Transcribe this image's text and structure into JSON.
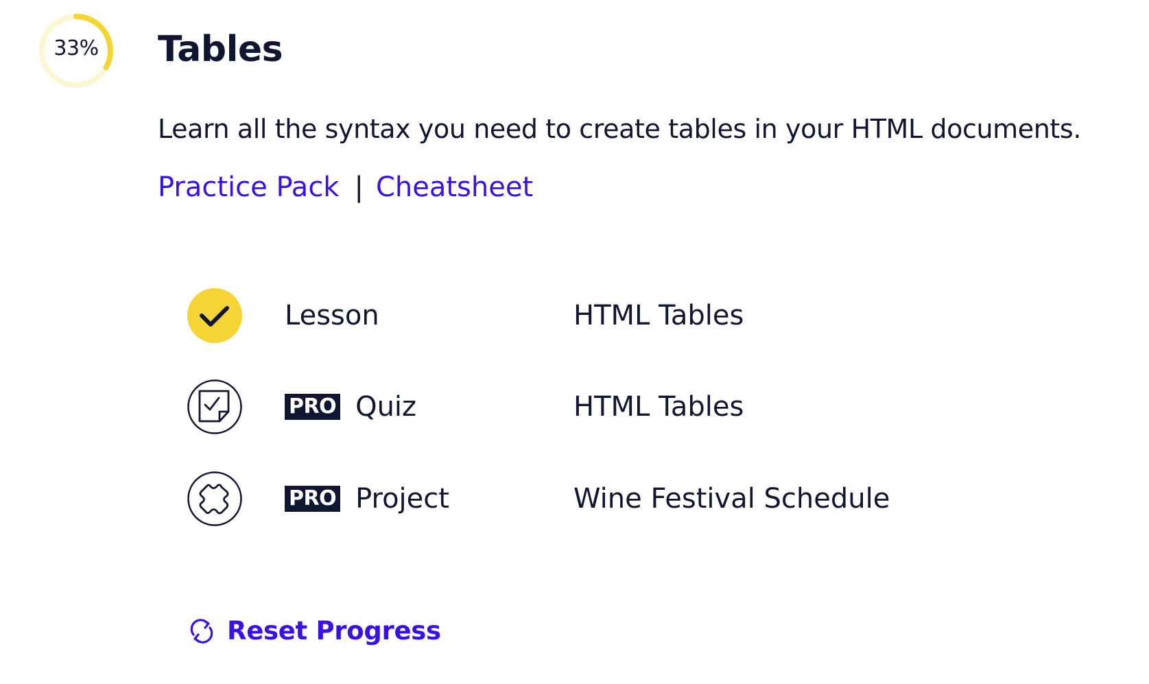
{
  "module": {
    "progress": 33,
    "progress_label": "33%",
    "title": "Tables",
    "description": "Learn all the syntax you need to create tables in your HTML documents.",
    "links": {
      "practice_pack": "Practice Pack",
      "separator": "|",
      "cheatsheet": "Cheatsheet"
    }
  },
  "items": [
    {
      "icon": "check-icon",
      "status": "completed",
      "badge": "",
      "type": "Lesson",
      "name": "HTML Tables"
    },
    {
      "icon": "quiz-icon",
      "status": "locked",
      "badge": "PRO",
      "type": "Quiz",
      "name": "HTML Tables"
    },
    {
      "icon": "puzzle-icon",
      "status": "locked",
      "badge": "PRO",
      "type": "Project",
      "name": "Wine Festival Schedule"
    }
  ],
  "reset": {
    "label": "Reset Progress",
    "icon": "refresh-icon"
  },
  "colors": {
    "accent": "#3a10e5",
    "text": "#10162f",
    "progress": "#f4d535",
    "progress_track": "#fdf6d3"
  }
}
